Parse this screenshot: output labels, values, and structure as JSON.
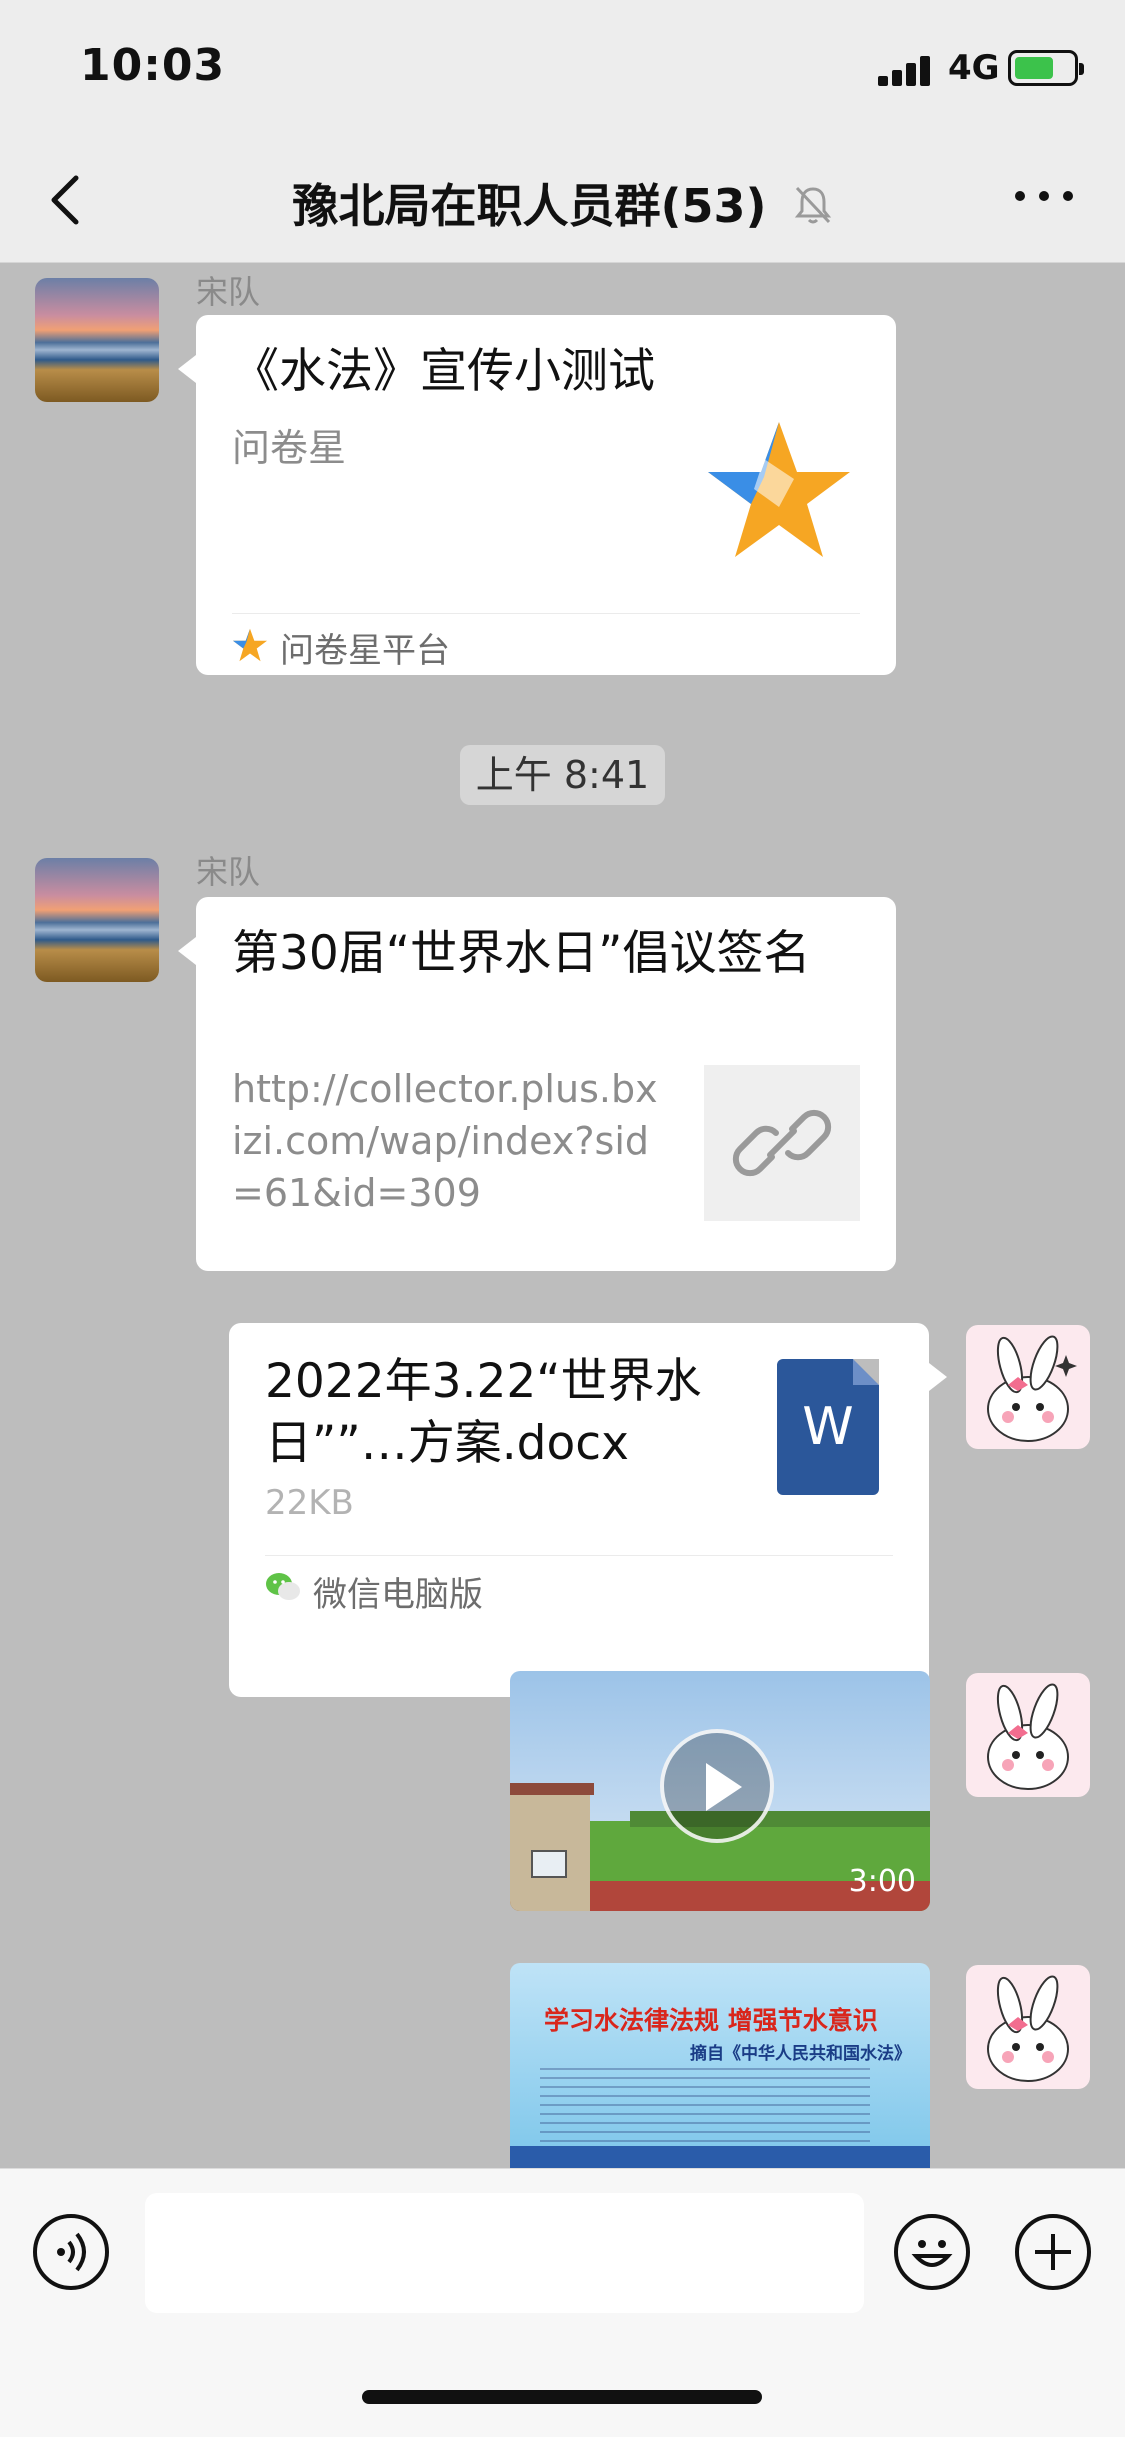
{
  "status": {
    "time": "10:03",
    "network": "4G"
  },
  "header": {
    "title": "豫北局在职人员群(53)"
  },
  "messages": {
    "m1": {
      "sender": "宋队",
      "title": "《水法》宣传小测试",
      "source": "问卷星",
      "footer": "问卷星平台"
    },
    "timestamp": "上午 8:41",
    "m2": {
      "sender": "宋队",
      "title": "第30届“世界水日”倡议签名",
      "url": "http://collector.plus.bxizi.com/wap/index?sid=61&id=309"
    },
    "m3": {
      "file_name": "2022年3.22“世界水日””…方案.docx",
      "file_size": "22KB",
      "file_icon_letter": "W",
      "footer": "微信电脑版"
    },
    "m4": {
      "duration": "3:00"
    },
    "m5": {
      "poster_title": "学习水法律法规  增强节水意识",
      "poster_sub": "摘自《中华人民共和国水法》"
    }
  },
  "icons": [
    "back-icon",
    "mute-icon",
    "more-icon",
    "voice-icon",
    "emoji-icon",
    "plus-icon",
    "link-icon",
    "star-icon",
    "wechat-icon",
    "word-icon",
    "play-icon"
  ]
}
